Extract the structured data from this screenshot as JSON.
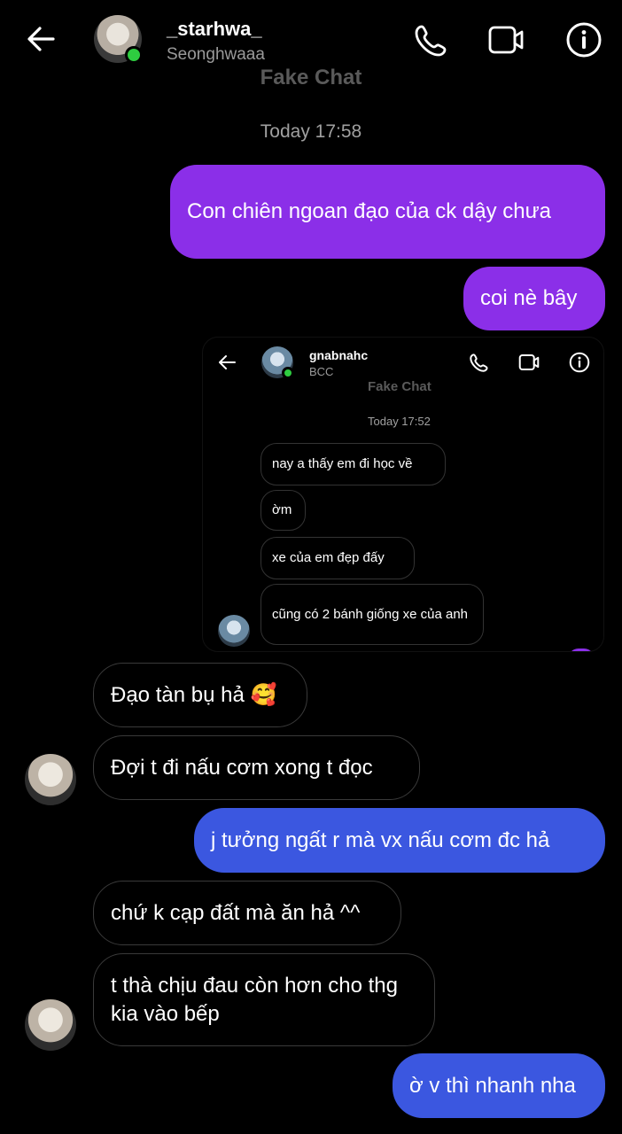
{
  "header": {
    "username": "_starhwa_",
    "handle": "Seonghwaaa",
    "watermark": "Fake Chat",
    "timestamp": "Today 17:58"
  },
  "icons": {
    "back": "arrow-left-icon",
    "phone": "phone-icon",
    "video": "video-camera-icon",
    "info": "info-icon"
  },
  "colors": {
    "sent_purple": "#8b2fe8",
    "sent_blue": "#3b57e0",
    "online": "#2ecc40",
    "background": "#000000"
  },
  "messages": [
    {
      "side": "sent",
      "text": "Con chiên ngoan đạo của ck dậy chưa"
    },
    {
      "side": "sent",
      "text": "coi nè bây"
    },
    {
      "side": "received",
      "text": "Đạo tàn bụ hả 🥰"
    },
    {
      "side": "received",
      "text": "Đợi t đi nấu cơm xong t đọc"
    },
    {
      "side": "sent",
      "text": "j tưởng ngất r mà vx nấu cơm đc hả"
    },
    {
      "side": "received",
      "text": "chứ k cạp đất mà ăn hả ^^"
    },
    {
      "side": "received",
      "text": "t thà chịu đau còn hơn cho thg kia vào bếp"
    },
    {
      "side": "sent",
      "text": "ờ v thì nhanh nha"
    }
  ],
  "embedded": {
    "username": "gnabnahc",
    "handle": "BCC",
    "watermark": "Fake Chat",
    "timestamp": "Today 17:52",
    "messages": [
      "nay a thấy em đi học về",
      "ờm",
      "xe của em đẹp đấy",
      "cũng có 2 bánh giống xe của anh"
    ]
  }
}
